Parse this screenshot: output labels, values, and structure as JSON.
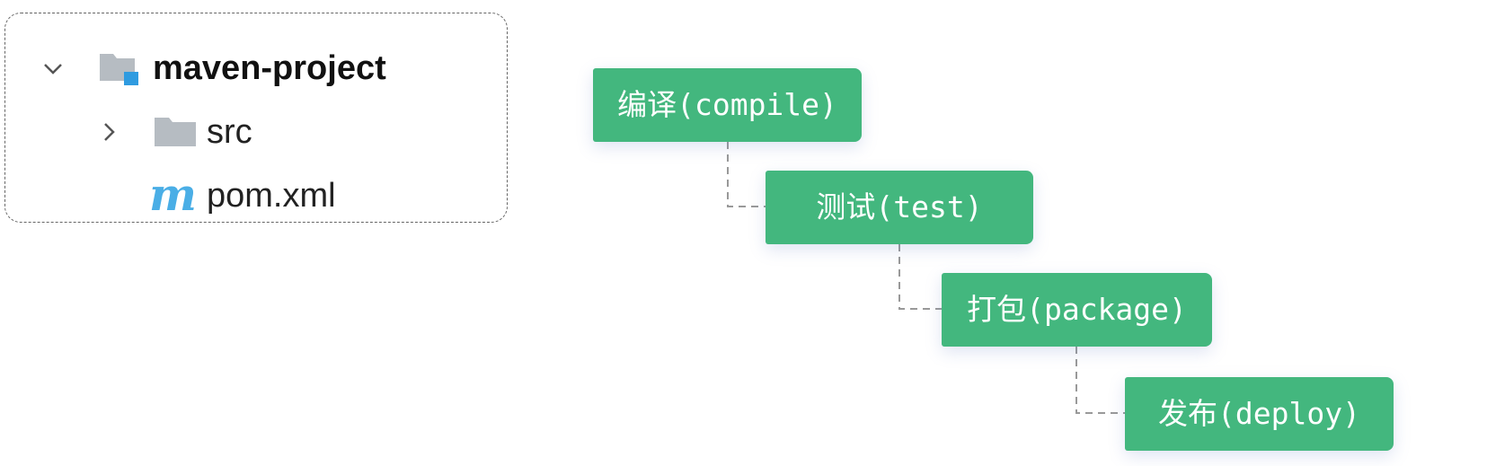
{
  "project_tree": {
    "root": {
      "label": "maven-project",
      "expanded": true,
      "icon": "module-folder-icon"
    },
    "children": [
      {
        "label": "src",
        "expanded": false,
        "icon": "folder-icon"
      },
      {
        "label": "pom.xml",
        "icon": "maven-icon"
      }
    ],
    "colors": {
      "folder": "#b6bcc2",
      "module_badge": "#2f9be0",
      "maven_icon": "#4aaee6"
    }
  },
  "lifecycle": {
    "stages": [
      {
        "label": "编译(compile)"
      },
      {
        "label": "测试(test)"
      },
      {
        "label": "打包(package)"
      },
      {
        "label": "发布(deploy)"
      }
    ],
    "colors": {
      "stage_fill": "#43b77e",
      "stage_text": "#ffffff",
      "connector": "#999999"
    }
  }
}
